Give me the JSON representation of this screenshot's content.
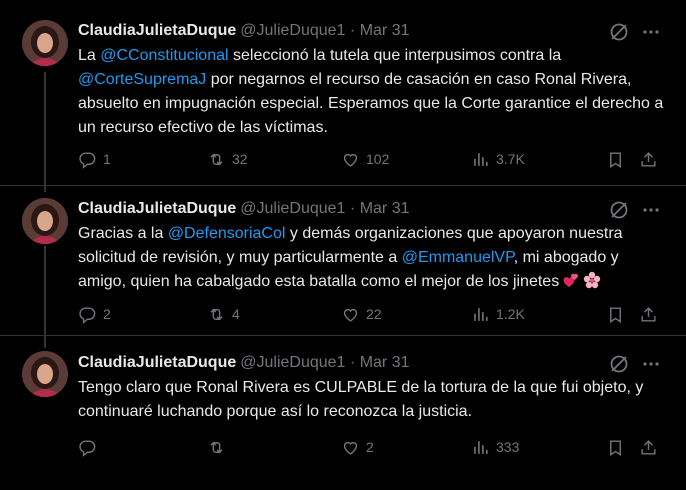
{
  "tweets": [
    {
      "name": "ClaudiaJulietaDuque",
      "handle": "@JulieDuque1",
      "dot": "·",
      "date": "Mar 31",
      "text": {
        "p1": "La ",
        "m1": "@CConstitucional",
        "p2": " seleccionó la tutela que interpusimos contra la ",
        "m2": "@CorteSupremaJ",
        "p3": " por negarnos el recurso de casación en caso Ronal Rivera, absuelto en impugnación especial. Esperamos que la Corte garantice el derecho a un recurso efectivo de las víctimas."
      },
      "replies": "1",
      "reposts": "32",
      "likes": "102",
      "views": "3.7K"
    },
    {
      "name": "ClaudiaJulietaDuque",
      "handle": "@JulieDuque1",
      "dot": "·",
      "date": "Mar 31",
      "text": {
        "p1": "Gracias a la ",
        "m1": "@DefensoriaCol",
        "p2": " y demás organizaciones que apoyaron nuestra solicitud de revisión, y muy particularmente a ",
        "m2": "@EmmanuelVP",
        "p3": ", mi abogado y amigo, quien ha cabalgado esta batalla como el mejor de los jinetes"
      },
      "replies": "2",
      "reposts": "4",
      "likes": "22",
      "views": "1.2K"
    },
    {
      "name": "ClaudiaJulietaDuque",
      "handle": "@JulieDuque1",
      "dot": "·",
      "date": "Mar 31",
      "text": {
        "p1": "Tengo claro que Ronal Rivera es CULPABLE de la tortura de la que fui objeto, y continuaré luchando porque así lo reconozca la justicia."
      },
      "replies": "",
      "reposts": "",
      "likes": "2",
      "views": "333"
    }
  ],
  "icons": {
    "reply": "reply-icon",
    "repost": "repost-icon",
    "like": "heart-icon",
    "views": "views-icon",
    "bookmark": "bookmark-icon",
    "share": "share-icon",
    "grok": "grok-icon",
    "more": "more-icon"
  },
  "colors": {
    "background": "#000000",
    "text": "#e7e9ea",
    "muted": "#71767b",
    "mention": "#1d9bf0",
    "divider": "#2f3336"
  }
}
